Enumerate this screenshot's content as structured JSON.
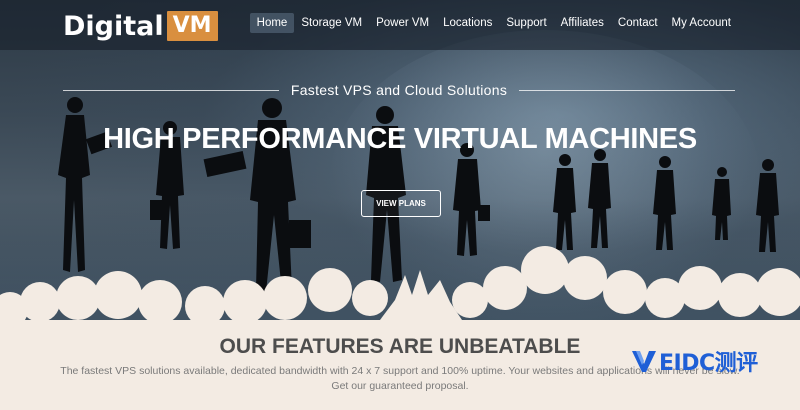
{
  "brand": {
    "name_part1": "Digital",
    "name_part2": "VM",
    "accent_color": "#d98f3f"
  },
  "nav": {
    "items": [
      {
        "label": "Home",
        "active": true
      },
      {
        "label": "Storage VM",
        "active": false
      },
      {
        "label": "Power VM",
        "active": false
      },
      {
        "label": "Locations",
        "active": false
      },
      {
        "label": "Support",
        "active": false
      },
      {
        "label": "Affiliates",
        "active": false
      },
      {
        "label": "Contact",
        "active": false
      },
      {
        "label": "My Account",
        "active": false
      }
    ]
  },
  "hero": {
    "tagline": "Fastest VPS and Cloud Solutions",
    "title": "HIGH PERFORMANCE VIRTUAL MACHINES",
    "cta_label": "VIEW PLANS"
  },
  "features": {
    "title": "OUR FEATURES ARE UNBEATABLE",
    "description": "The fastest VPS solutions available, dedicated bandwidth with 24 x 7 support and 100% uptime. Your websites and applications will never be slow. Get our guaranteed proposal."
  },
  "watermark": {
    "text": "EIDC测评",
    "color": "#1f5fd6"
  }
}
